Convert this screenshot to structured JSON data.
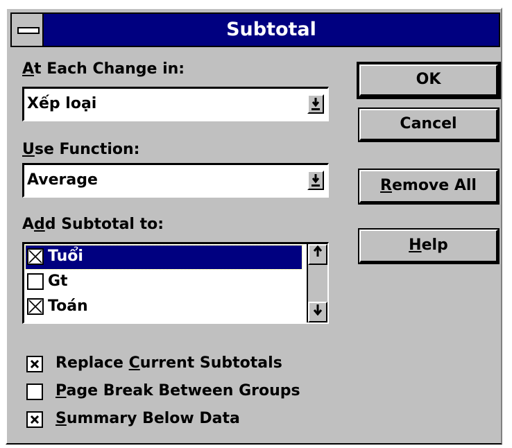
{
  "window": {
    "title": "Subtotal"
  },
  "at_each_change": {
    "label_accel": "A",
    "label_rest": "t Each Change in:",
    "value": "Xếp loại"
  },
  "use_function": {
    "label_accel": "U",
    "label_rest": "se Function:",
    "value": "Average"
  },
  "add_subtotal": {
    "label_pre": "A",
    "label_accel": "d",
    "label_rest": "d Subtotal to:",
    "items": [
      {
        "label": "Tuổi",
        "checked": true,
        "selected": true
      },
      {
        "label": "Gt",
        "checked": false,
        "selected": false
      },
      {
        "label": "Toán",
        "checked": true,
        "selected": false
      }
    ]
  },
  "buttons": {
    "ok": "OK",
    "cancel": "Cancel",
    "remove_all_accel": "R",
    "remove_all_rest": "emove All",
    "help_accel": "H",
    "help_rest": "elp"
  },
  "options": {
    "replace_pre": "Replace ",
    "replace_accel": "C",
    "replace_rest": "urrent Subtotals",
    "replace_checked": true,
    "pagebreak_accel": "P",
    "pagebreak_rest": "age Break Between Groups",
    "pagebreak_checked": false,
    "summary_accel": "S",
    "summary_rest": "ummary Below Data",
    "summary_checked": true
  },
  "icons": {
    "system_menu": "minus-bar-icon",
    "dropdown": "arrow-down-icon",
    "scroll_up": "arrow-up-icon",
    "scroll_down": "arrow-down-icon",
    "checked": "x-mark-icon"
  },
  "colors": {
    "titlebar": "#000080",
    "face": "#c0c0c0",
    "selection": "#000080"
  }
}
